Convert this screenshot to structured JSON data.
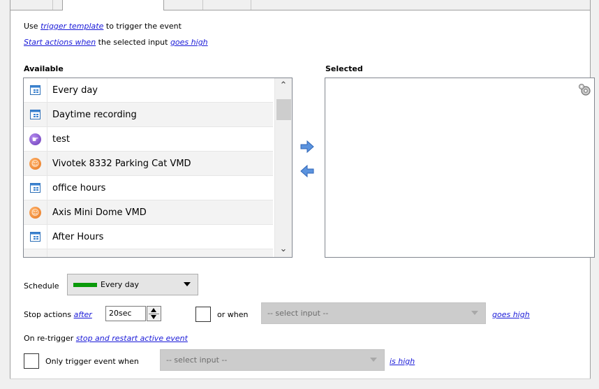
{
  "trigger_line": {
    "prefix": "Use",
    "link": "trigger template",
    "suffix": "to trigger the event"
  },
  "start_line": {
    "link": "Start actions when",
    "middle": "the selected input",
    "link2": "goes high"
  },
  "available": {
    "label": "Available",
    "items": [
      {
        "label": "Every day",
        "icon": "calendar-icon"
      },
      {
        "label": "Daytime recording",
        "icon": "calendar-icon"
      },
      {
        "label": "test",
        "icon": "hand-pointer-icon"
      },
      {
        "label": "Vivotek 8332 Parking Cat VMD",
        "icon": "motion-person-icon"
      },
      {
        "label": "office hours",
        "icon": "calendar-icon"
      },
      {
        "label": "Axis Mini Dome VMD",
        "icon": "motion-person-icon"
      },
      {
        "label": "After Hours",
        "icon": "calendar-icon"
      }
    ]
  },
  "selected": {
    "label": "Selected"
  },
  "schedule": {
    "label": "Schedule",
    "value": "Every day",
    "swatch_color": "#0a9a0a"
  },
  "stop_actions": {
    "label": "Stop actions",
    "link": "after",
    "value": "20sec",
    "or_when_label": "or when",
    "select_placeholder": "-- select input --",
    "goes_high": "goes high"
  },
  "retrigger": {
    "label": "On re-trigger",
    "link": "stop and restart active event"
  },
  "only_trigger": {
    "label": "Only trigger event when",
    "select_placeholder": "-- select input --",
    "is_high": "is high"
  },
  "colors": {
    "link": "#1a1ad8",
    "arrow_blue": "#4a86d8"
  }
}
